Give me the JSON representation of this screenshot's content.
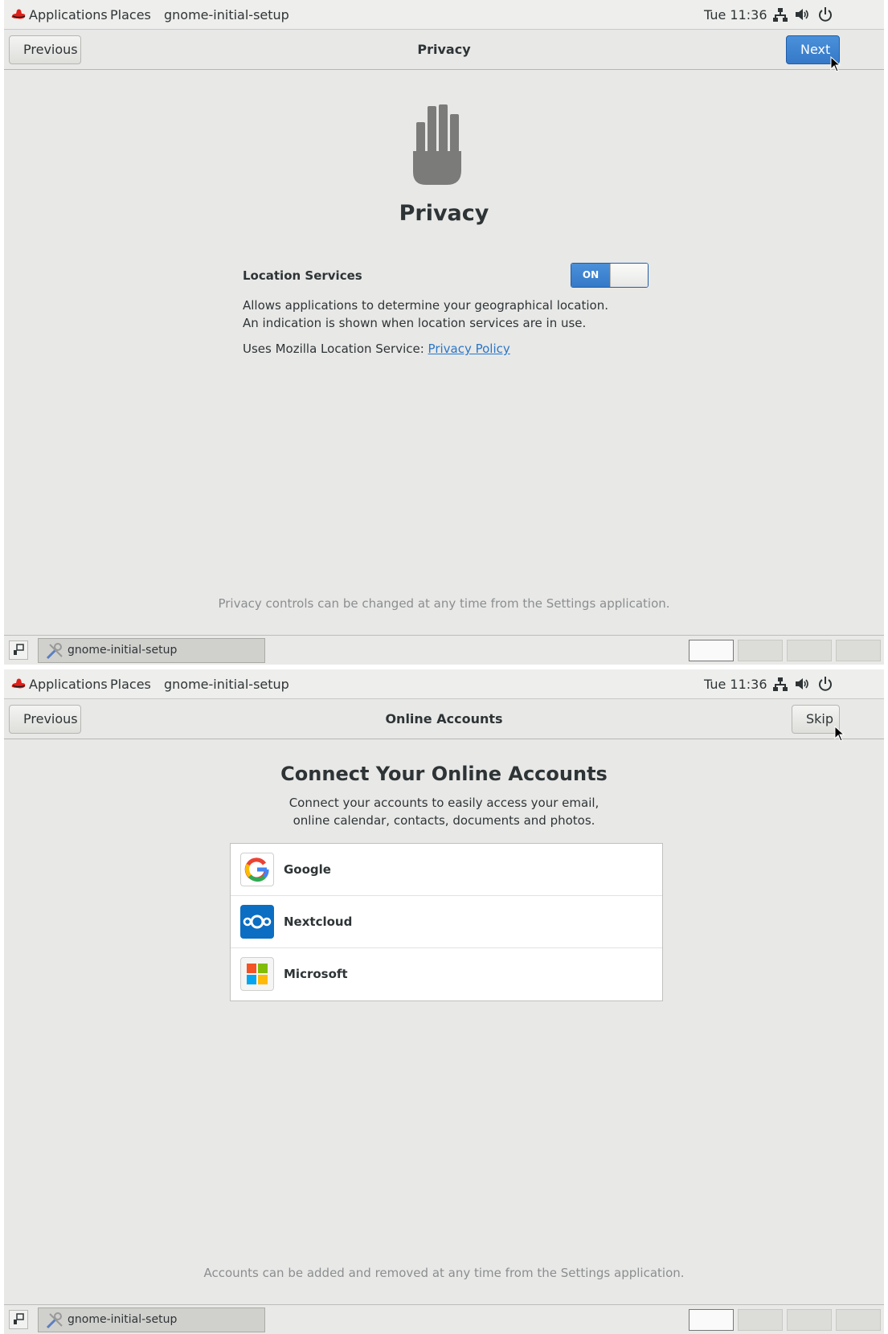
{
  "screens": [
    {
      "topbar": {
        "applications": "Applications",
        "places": "Places",
        "active_app": "gnome-initial-setup",
        "clock": "Tue 11:36",
        "icons": [
          "network-wired-icon",
          "volume-icon",
          "power-icon"
        ]
      },
      "header": {
        "previous": "Previous",
        "title": "Privacy",
        "next": "Next"
      },
      "page": {
        "icon": "privacy-hand-icon",
        "heading": "Privacy",
        "location_label": "Location Services",
        "toggle_state": "ON",
        "description": "Allows applications to determine your geographical location. An indication is shown when location services are in use.",
        "service_prefix": "Uses Mozilla Location Service: ",
        "policy_link": "Privacy Policy",
        "footer": "Privacy controls can be changed at any time from the Settings application."
      },
      "taskbar": {
        "task_label": "gnome-initial-setup",
        "workspaces": 4,
        "active_workspace": 1
      }
    },
    {
      "topbar": {
        "applications": "Applications",
        "places": "Places",
        "active_app": "gnome-initial-setup",
        "clock": "Tue 11:36",
        "icons": [
          "network-wired-icon",
          "volume-icon",
          "power-icon"
        ]
      },
      "header": {
        "previous": "Previous",
        "title": "Online Accounts",
        "skip": "Skip"
      },
      "page": {
        "heading": "Connect Your Online Accounts",
        "subtitle_line1": "Connect your accounts to easily access your email,",
        "subtitle_line2": "online calendar, contacts, documents and photos.",
        "accounts": [
          {
            "label": "Google",
            "icon": "google-icon"
          },
          {
            "label": "Nextcloud",
            "icon": "nextcloud-icon"
          },
          {
            "label": "Microsoft",
            "icon": "microsoft-icon"
          }
        ],
        "footer": "Accounts can be added and removed at any time from the Settings application."
      },
      "taskbar": {
        "task_label": "gnome-initial-setup",
        "workspaces": 4,
        "active_workspace": 1
      }
    }
  ],
  "colors": {
    "accent_blue": "#3b83d4",
    "background": "#e8e8e7",
    "link": "#2a76c6",
    "muted_text": "#8b8e8f"
  }
}
